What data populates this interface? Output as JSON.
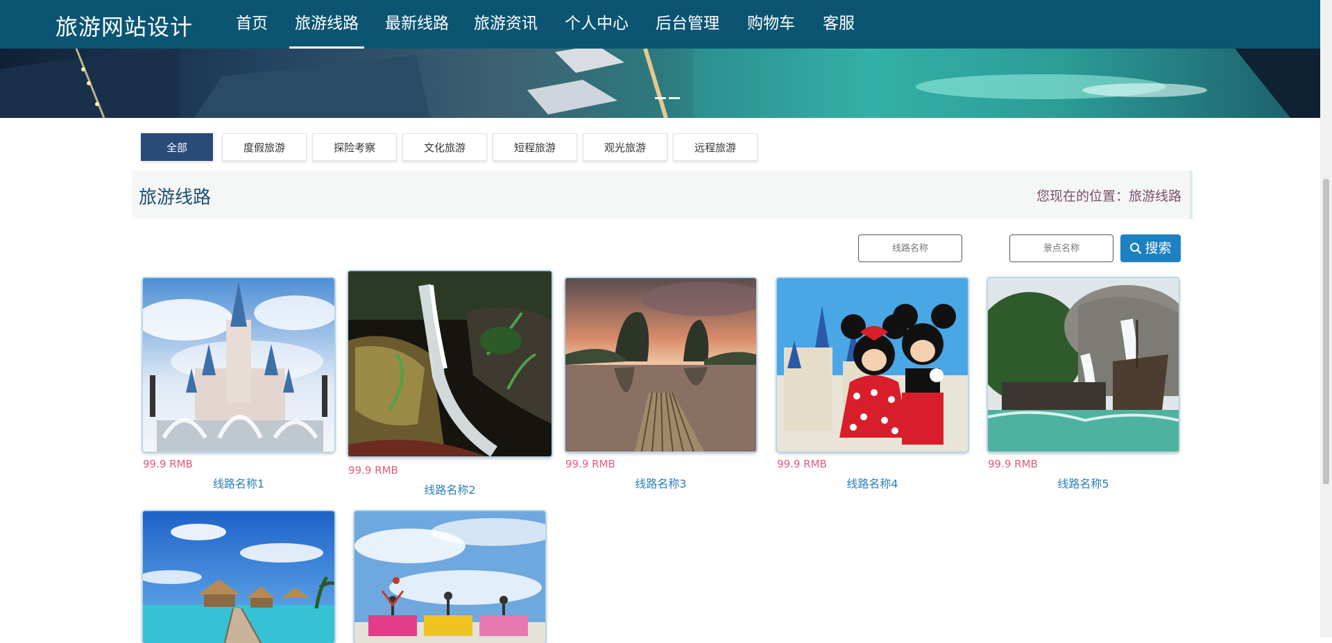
{
  "site": {
    "title": "旅游网站设计"
  },
  "nav": {
    "items": [
      {
        "label": "首页"
      },
      {
        "label": "旅游线路"
      },
      {
        "label": "最新线路"
      },
      {
        "label": "旅游资讯"
      },
      {
        "label": "个人中心"
      },
      {
        "label": "后台管理"
      },
      {
        "label": "购物车"
      },
      {
        "label": "客服"
      }
    ],
    "active": "旅游线路"
  },
  "categories": {
    "items": [
      {
        "label": "全部"
      },
      {
        "label": "度假旅游"
      },
      {
        "label": "探险考察"
      },
      {
        "label": "文化旅游"
      },
      {
        "label": "短程旅游"
      },
      {
        "label": "观光旅游"
      },
      {
        "label": "远程旅游"
      }
    ],
    "active": "全部"
  },
  "section": {
    "title": "旅游线路",
    "breadcrumb_prefix": "您现在的位置：",
    "breadcrumb_current": "旅游线路"
  },
  "search": {
    "route_placeholder": "线路名称",
    "spot_placeholder": "景点名称",
    "button_label": "搜索"
  },
  "routes": [
    {
      "name": "线路名称1",
      "price": "99.9 RMB",
      "image": "castle-fountain"
    },
    {
      "name": "线路名称2",
      "price": "99.9 RMB",
      "image": "waterfall-rocks"
    },
    {
      "name": "线路名称3",
      "price": "99.9 RMB",
      "image": "river-bamboo-raft"
    },
    {
      "name": "线路名称4",
      "price": "99.9 RMB",
      "image": "mickey-minnie-castle"
    },
    {
      "name": "线路名称5",
      "price": "99.9 RMB",
      "image": "pirate-ship-waterfall"
    },
    {
      "name": "",
      "price": "",
      "image": "overwater-bungalows"
    },
    {
      "name": "",
      "price": "",
      "image": "colorful-jeeps-sky"
    }
  ],
  "colors": {
    "topbar": "#0b5573",
    "tab_active": "#2a4b7a",
    "price": "#e45b7b",
    "route_name": "#2a7fb6",
    "search_button": "#1c80c1"
  }
}
